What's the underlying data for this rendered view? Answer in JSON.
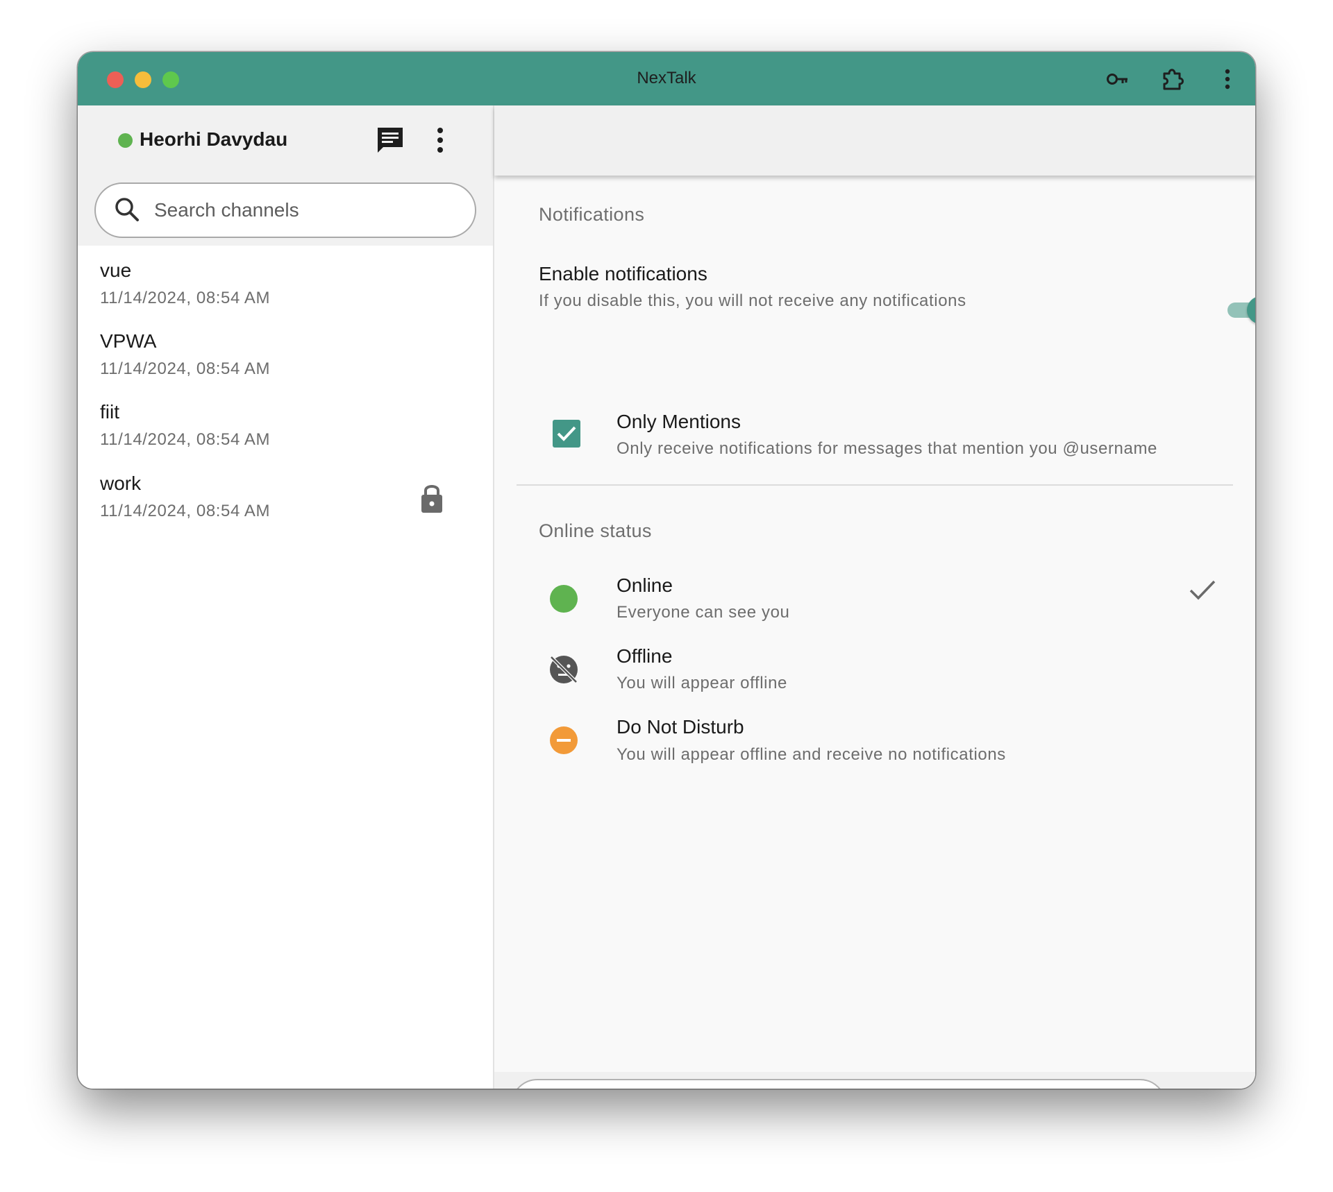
{
  "window": {
    "title": "NexTalk"
  },
  "titlebar_icons": [
    "key-icon",
    "extension-icon",
    "more-vert-icon"
  ],
  "user": {
    "name": "Heorhi Davydau",
    "status": "online",
    "status_color": "#5fb350"
  },
  "sidebar": {
    "search_placeholder": "Search channels",
    "channels": [
      {
        "name": "vue",
        "time": "11/14/2024, 08:54 AM",
        "locked": false
      },
      {
        "name": "VPWA",
        "time": "11/14/2024, 08:54 AM",
        "locked": false
      },
      {
        "name": "fiit",
        "time": "11/14/2024, 08:54 AM",
        "locked": false
      },
      {
        "name": "work",
        "time": "11/14/2024, 08:54 AM",
        "locked": true
      }
    ]
  },
  "settings": {
    "notifications": {
      "section_title": "Notifications",
      "enable": {
        "title": "Enable notifications",
        "subtitle": "If you disable this, you will not receive any notifications",
        "enabled": true
      },
      "only_mentions": {
        "title": "Only Mentions",
        "subtitle": "Only receive notifications for messages that mention you @username",
        "checked": true
      }
    },
    "online_status": {
      "section_title": "Online status",
      "options": [
        {
          "title": "Online",
          "subtitle": "Everyone can see you",
          "icon": "online-dot-icon",
          "color": "#5fb350",
          "selected": true
        },
        {
          "title": "Offline",
          "subtitle": "You will appear offline",
          "icon": "offline-icon",
          "color": "#5a5a5a",
          "selected": false
        },
        {
          "title": "Do Not Disturb",
          "subtitle": "You will appear offline and receive no notifications",
          "icon": "do-not-disturb-icon",
          "color": "#f29a38",
          "selected": false
        }
      ]
    }
  },
  "composer": {
    "value": "",
    "placeholder": ""
  },
  "colors": {
    "accent": "#439787",
    "titlebar": "#439787",
    "panel": "#f0f0f0"
  }
}
